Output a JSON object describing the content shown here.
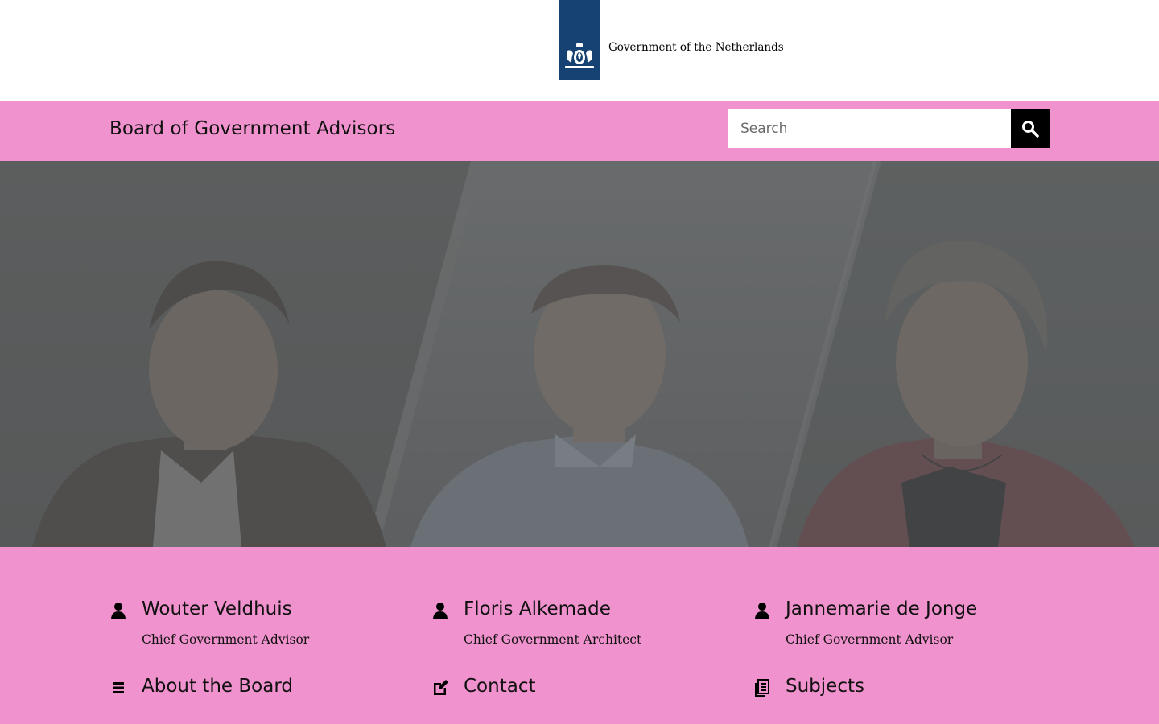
{
  "brand": {
    "logo_text": "Government of the Netherlands",
    "logo_color": "#154273"
  },
  "header": {
    "site_title": "Board of Government Advisors",
    "background": "#f092cd",
    "search": {
      "placeholder": "Search",
      "value": ""
    },
    "search_button_icon": "search-icon"
  },
  "hero": {
    "image_description_icon": "portrait-photo"
  },
  "people": [
    {
      "name": "Wouter Veldhuis",
      "role": "Chief Government Advisor",
      "icon": "person-icon"
    },
    {
      "name": "Floris Alkemade",
      "role": "Chief Government Architect",
      "icon": "person-icon"
    },
    {
      "name": "Jannemarie de Jonge",
      "role": "Chief Government Advisor",
      "icon": "person-icon"
    }
  ],
  "links": [
    {
      "label": "About the Board",
      "icon": "list-icon"
    },
    {
      "label": "Contact",
      "icon": "edit-icon"
    },
    {
      "label": "Subjects",
      "icon": "document-icon"
    }
  ]
}
